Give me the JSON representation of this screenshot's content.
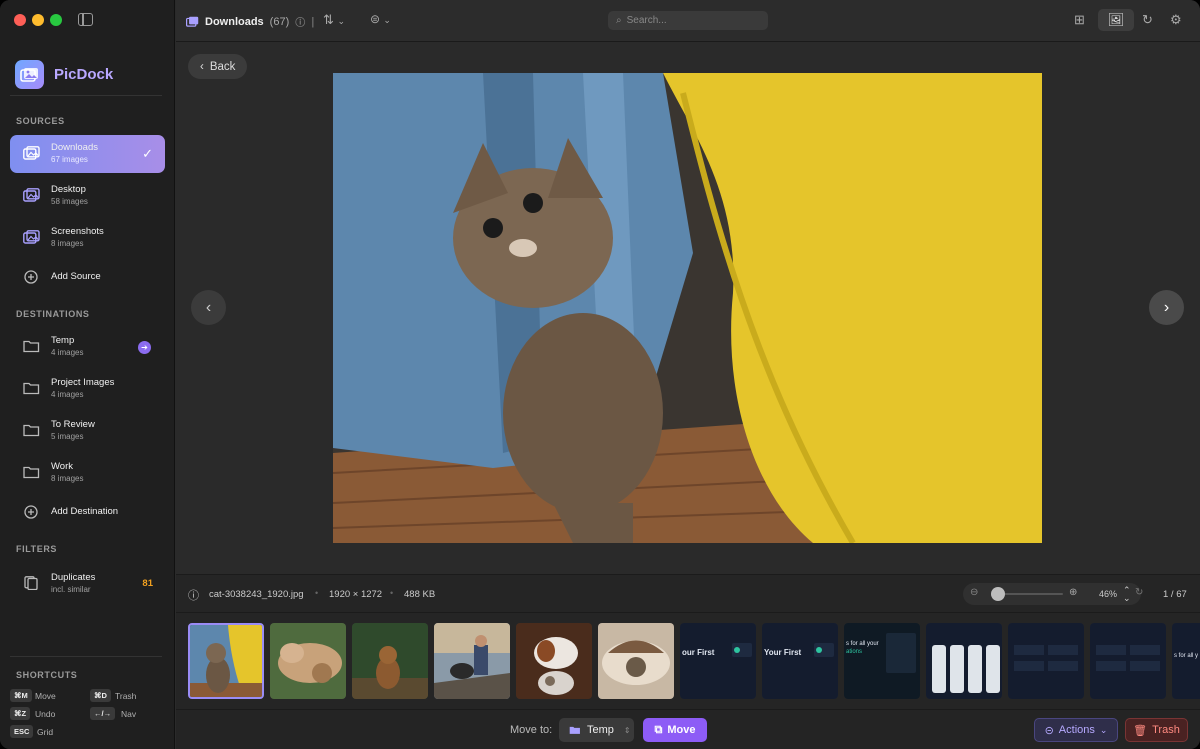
{
  "app": {
    "name": "PicDock"
  },
  "sidebar": {
    "sources_heading": "SOURCES",
    "sources": [
      {
        "label": "Downloads",
        "sub": "67 images",
        "active": true
      },
      {
        "label": "Desktop",
        "sub": "58 images"
      },
      {
        "label": "Screenshots",
        "sub": "8 images"
      }
    ],
    "add_source": "Add Source",
    "destinations_heading": "DESTINATIONS",
    "destinations": [
      {
        "label": "Temp",
        "sub": "4 images"
      },
      {
        "label": "Project Images",
        "sub": "4 images"
      },
      {
        "label": "To Review",
        "sub": "5 images"
      },
      {
        "label": "Work",
        "sub": "8 images"
      }
    ],
    "add_destination": "Add Destination",
    "filters_heading": "FILTERS",
    "filters": [
      {
        "label": "Duplicates",
        "sub": "incl. similar",
        "count": "81"
      }
    ],
    "shortcuts_heading": "SHORTCUTS",
    "shortcuts": [
      {
        "key": "⌘M",
        "label": "Move"
      },
      {
        "key": "⌘D",
        "label": "Trash"
      },
      {
        "key": "⌘Z",
        "label": "Undo"
      },
      {
        "key": "←/→",
        "label": "Nav"
      },
      {
        "key": "ESC",
        "label": "Grid"
      }
    ]
  },
  "toolbar": {
    "title": "Downloads",
    "count": "(67)",
    "search_placeholder": "Search..."
  },
  "viewer": {
    "back_label": "Back"
  },
  "info": {
    "filename": "cat-3038243_1920.jpg",
    "dimensions": "1920 × 1272",
    "size": "488 KB",
    "zoom": "46%",
    "zoom_fraction": 0.08,
    "position": "1 / 67"
  },
  "bottom": {
    "move_to_label": "Move to:",
    "destination": "Temp",
    "move_label": "Move",
    "actions_label": "Actions",
    "trash_label": "Trash"
  },
  "colors": {
    "accent": "#8d5cf6",
    "active_item": "#8f8ff0",
    "danger": "#ff8a80"
  }
}
